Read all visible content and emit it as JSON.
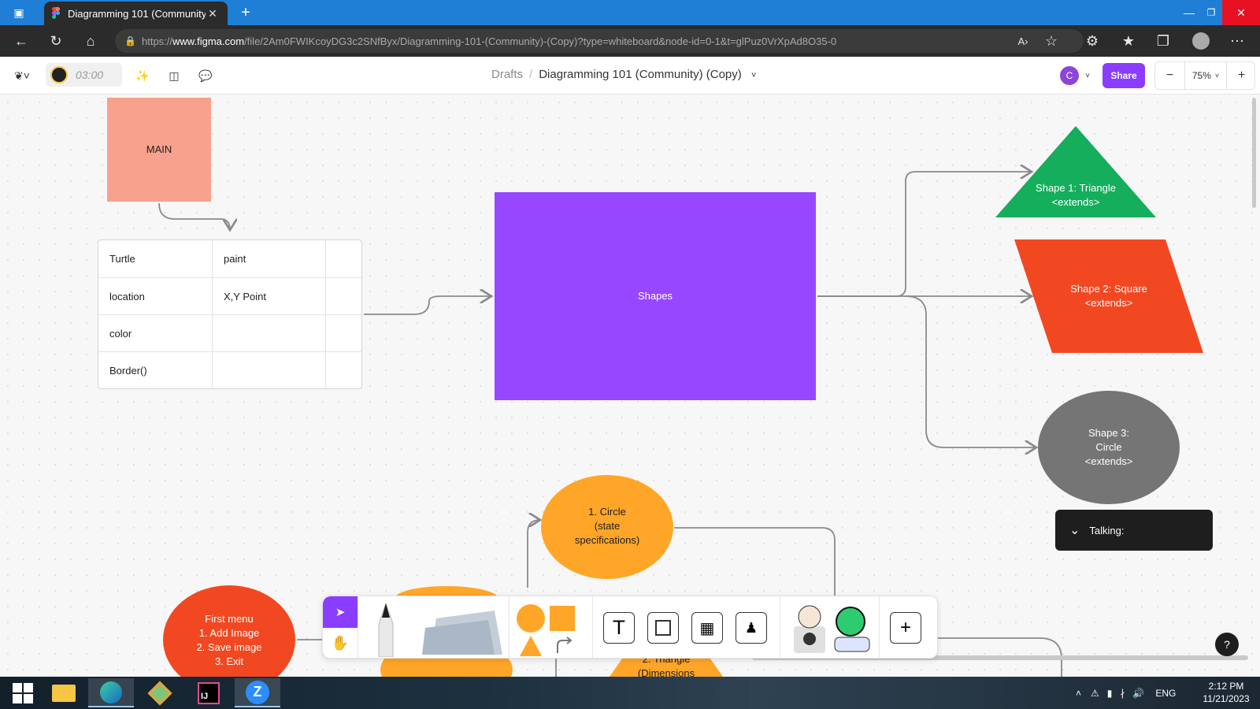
{
  "browser": {
    "tab_title": "Diagramming 101 (Community)",
    "url_prefix": "https://",
    "url_domain": "www.figma.com",
    "url_path": "/file/2Am0FWIKcoyDG3c2SNfByx/Diagramming-101-(Community)-(Copy)?type=whiteboard&node-id=0-1&t=glPuz0VrXpAd8O35-0"
  },
  "figma": {
    "timer": "03:00",
    "breadcrumb_parent": "Drafts",
    "file_name": "Diagramming 101 (Community) (Copy)",
    "user_initial": "C",
    "share_label": "Share",
    "zoom": "75%",
    "zoom_out": "−",
    "zoom_in": "+"
  },
  "canvas": {
    "main_label": "MAIN",
    "shapes_label": "Shapes",
    "triangle_line1": "Shape 1: Triangle",
    "triangle_line2": "<extends>",
    "square_line1": "Shape 2: Square",
    "square_line2": "<extends>",
    "circle_line1": "Shape 3:",
    "circle_line2": "Circle",
    "circle_line3": "<extends>",
    "circle_state_line1": "1. Circle",
    "circle_state_line2": "(state",
    "circle_state_line3": "specifications)",
    "first_menu": [
      "First menu",
      "1. Add Image",
      "2. Save image",
      "3. Exit"
    ],
    "triangle_dim_line1": "2. Triangle",
    "triangle_dim_line2": "(Dimensions",
    "table_rows": [
      [
        "Turtle",
        "paint",
        ""
      ],
      [
        "location",
        "X,Y Point",
        ""
      ],
      [
        "color",
        "",
        ""
      ],
      [
        "Border()",
        "",
        ""
      ]
    ],
    "talking_label": "Talking:",
    "help_label": "?"
  },
  "colors": {
    "main": "#f8a18d",
    "shapes": "#9747ff",
    "triangle": "#14ae5c",
    "square": "#f24822",
    "circle": "#757575",
    "orange": "#ffa629",
    "accent": "#8b3dff"
  },
  "taskbar": {
    "language": "ENG",
    "time": "2:12 PM",
    "date": "11/21/2023"
  }
}
